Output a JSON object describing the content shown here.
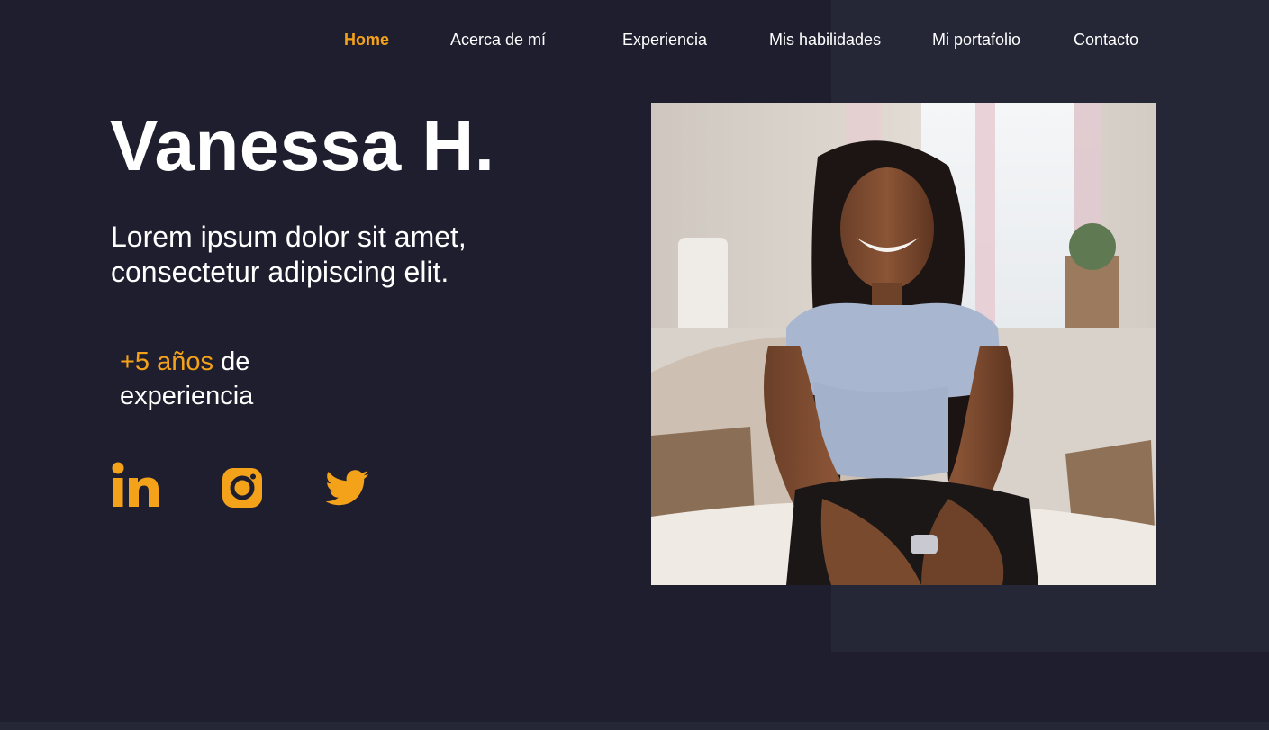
{
  "nav": {
    "items": [
      {
        "label": "Home",
        "active": true
      },
      {
        "label": "Acerca de mí",
        "active": false
      },
      {
        "label": "Experiencia",
        "active": false
      },
      {
        "label": "Mis habilidades",
        "active": false
      },
      {
        "label": "Mi portafolio",
        "active": false
      },
      {
        "label": "Contacto",
        "active": false
      }
    ]
  },
  "hero": {
    "name": "Vanessa H.",
    "subtitle": "Lorem ipsum dolor sit amet, consectetur adipiscing elit.",
    "experience_highlight": "+5 años",
    "experience_rest": " de experiencia"
  },
  "social": [
    {
      "icon": "linkedin-icon"
    },
    {
      "icon": "instagram-icon"
    },
    {
      "icon": "twitter-icon"
    }
  ],
  "colors": {
    "background": "#1f1e2e",
    "panel": "#252636",
    "accent": "#f5a21b",
    "text": "#ffffff"
  }
}
